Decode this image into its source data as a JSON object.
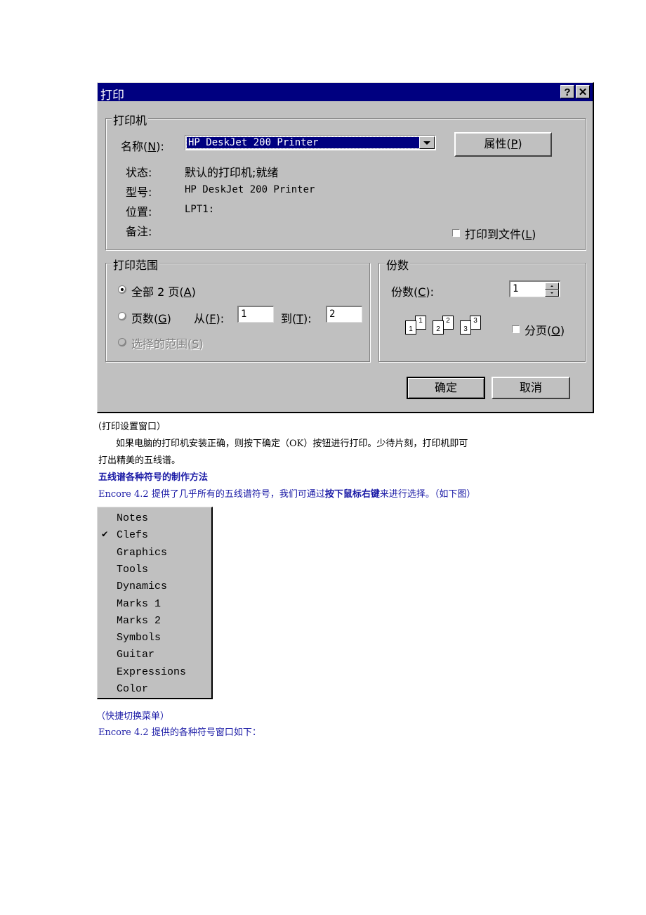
{
  "dialog": {
    "title": "打印",
    "help_label": "?",
    "close_label": "✕",
    "printer_group": {
      "label": "打印机",
      "name_label": "名称(",
      "name_accel": "N",
      "name_label_end": "):",
      "name_value": "HP DeskJet 200 Printer",
      "properties_button": "属性(",
      "properties_accel": "P",
      "properties_end": ")",
      "status_label": "状态:",
      "status_value": "默认的打印机;就绪",
      "type_label": "型号:",
      "type_value": "HP DeskJet 200 Printer",
      "where_label": "位置:",
      "where_value": "LPT1:",
      "comment_label": "备注:",
      "print_to_file_label": "打印到文件(",
      "print_to_file_accel": "L",
      "print_to_file_end": ")",
      "print_to_file_checked": false
    },
    "range_group": {
      "label": "打印范围",
      "all_label": "全部 2 页(",
      "all_accel": "A",
      "all_end": ")",
      "pages_label": "页数(",
      "pages_accel": "G",
      "pages_end": ")",
      "from_label": "从(",
      "from_accel": "F",
      "from_end": "):",
      "from_value": "1",
      "to_label": "到(",
      "to_accel": "T",
      "to_end": "):",
      "to_value": "2",
      "selection_label": "选择的范围(",
      "selection_accel": "S",
      "selection_end": ")",
      "selected": "all"
    },
    "copies_group": {
      "label": "份数",
      "copies_label": "份数(",
      "copies_accel": "C",
      "copies_end": "):",
      "copies_value": "1",
      "collate_pages": [
        "1",
        "1",
        "2",
        "2",
        "3",
        "3"
      ],
      "collate_label": "分页(",
      "collate_accel": "O",
      "collate_end": ")",
      "collate_checked": false
    },
    "ok_button": "确定",
    "cancel_button": "取消"
  },
  "document": {
    "caption1": "（打印设置窗口）",
    "para1_line1": "如果电脑的打印机安装正确，则按下确定（OK）按钮进行打印。少待片刻，打印机即可",
    "para1_line2": "打出精美的五线谱。",
    "heading": "五线谱各种符号的制作方法",
    "para2_start": "Encore 4.2 提供了几乎所有的五线谱符号，我们可通过",
    "para2_bold": "按下鼠标右键",
    "para2_end": "来进行选择。（如下图）",
    "caption2": "（快捷切换菜单）",
    "para3": "Encore 4.2 提供的各种符号窗口如下："
  },
  "context_menu": {
    "items": [
      {
        "label": "Notes",
        "checked": false
      },
      {
        "label": "Clefs",
        "checked": true
      },
      {
        "label": "Graphics",
        "checked": false
      },
      {
        "label": "Tools",
        "checked": false
      },
      {
        "label": "Dynamics",
        "checked": false
      },
      {
        "label": "Marks 1",
        "checked": false
      },
      {
        "label": "Marks 2",
        "checked": false
      },
      {
        "label": "Symbols",
        "checked": false
      },
      {
        "label": "Guitar",
        "checked": false
      },
      {
        "label": "Expressions",
        "checked": false
      },
      {
        "label": "Color",
        "checked": false
      }
    ],
    "check_glyph": "✔"
  }
}
